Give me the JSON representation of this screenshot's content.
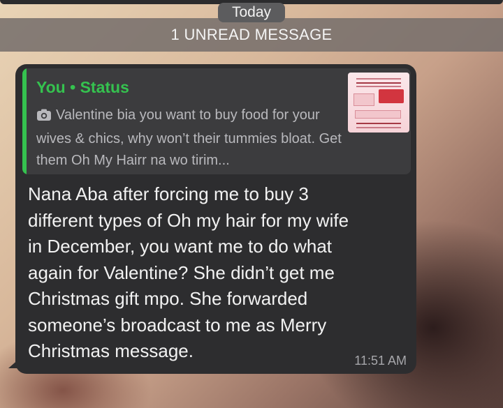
{
  "chat": {
    "date_label": "Today",
    "unread_label": "1 UNREAD MESSAGE",
    "message": {
      "reply": {
        "sender": "You",
        "separator": "•",
        "context": "Status",
        "media_icon": "camera-icon",
        "preview_text": "Valentine bia you want to buy food for your wives & chics, why won’t their tummies bloat. Get them Oh My Hairr na wo tirim..."
      },
      "body_lines": [
        "Nana Aba after forcing me to buy 3",
        "different types of Oh my hair for my wife",
        "in December, you want me to do what",
        "again for Valentine? She didn’t get me",
        "Christmas gift mpo. She forwarded",
        "someone’s broadcast to me as Merry",
        "Christmas message."
      ],
      "time": "11:51 AM"
    }
  },
  "colors": {
    "bubble_bg": "#2d2d2f",
    "quote_bg": "#3c3c3e",
    "accent_green": "#35c24f",
    "text_primary": "#f2f2f2",
    "text_secondary": "#b9b9bd"
  }
}
